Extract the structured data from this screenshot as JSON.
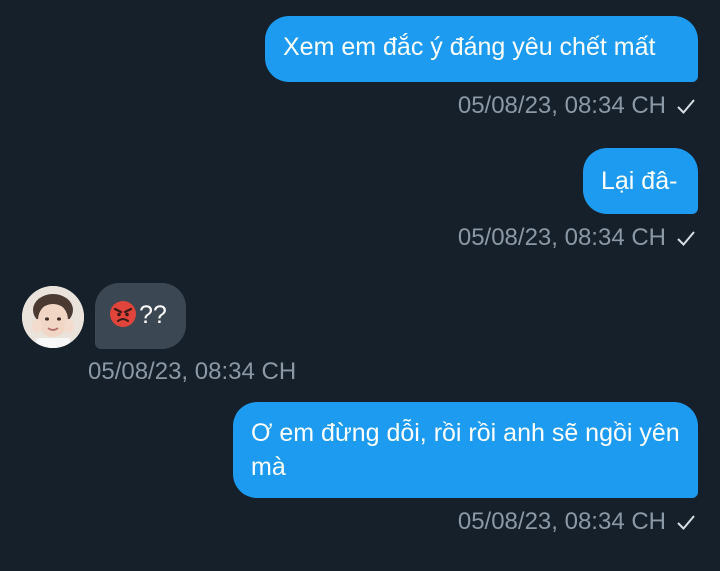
{
  "messages": [
    {
      "direction": "outgoing",
      "text": "Xem em đắc ý đáng yêu chết mất",
      "time": "05/08/23, 08:34 CH"
    },
    {
      "direction": "outgoing",
      "text": "Lại đâ-",
      "time": "05/08/23, 08:34 CH"
    },
    {
      "direction": "incoming",
      "emoji": "angry-face-icon",
      "text": "??",
      "time": "05/08/23, 08:34 CH"
    },
    {
      "direction": "outgoing",
      "text": "Ơ em đừng dỗi, rồi rồi anh sẽ ngồi yên mà",
      "time": "05/08/23, 08:34 CH"
    }
  ],
  "colors": {
    "background": "#15202b",
    "outgoing_bubble": "#1d9bf0",
    "incoming_bubble": "#3b4752",
    "meta_text": "#8b98a5"
  }
}
